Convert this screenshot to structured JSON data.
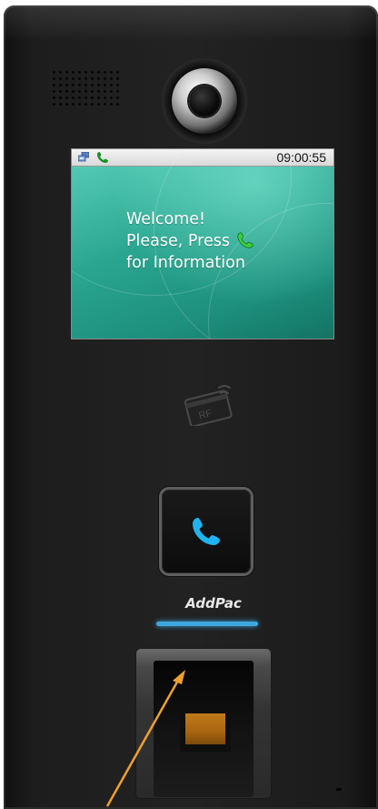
{
  "screen": {
    "status_time": "09:00:55",
    "message": {
      "line1": "Welcome!",
      "line2": "Please, Press",
      "line3": "for Information"
    }
  },
  "rf_reader": {
    "label": "RF"
  },
  "brand": {
    "name": "AddPac"
  },
  "icons": {
    "status_network": "network-icon",
    "status_phone": "phone-icon",
    "inline_phone": "phone-icon",
    "call_button": "phone-icon"
  },
  "colors": {
    "panel": "#1f1f1f",
    "screen_green": "#2aa690",
    "call_icon_blue": "#1fb4f0",
    "brand_bar_blue": "#3ea7e0",
    "status_phone_green": "#1a8f2a",
    "inline_phone_green": "#3ccf3c",
    "fingerprint_sensor": "#b06c14",
    "annotation_arrow": "#f0a030"
  }
}
